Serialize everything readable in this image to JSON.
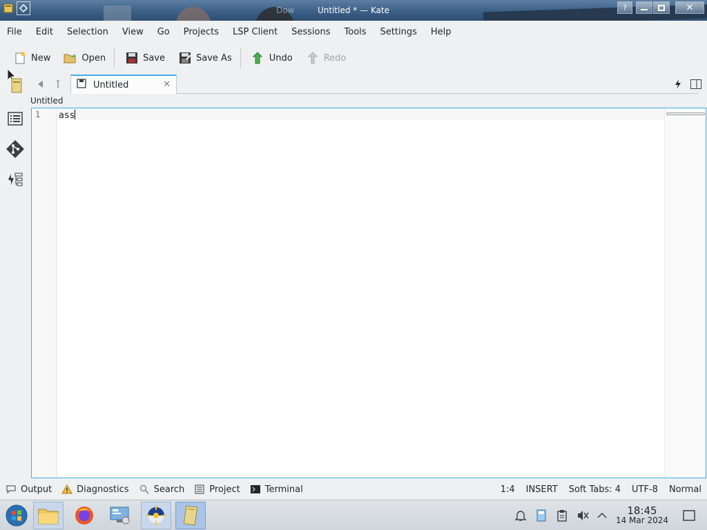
{
  "window": {
    "title": "Untitled * — Kate",
    "ghost_title": "Dow",
    "help_label": "?"
  },
  "menu": [
    "File",
    "Edit",
    "Selection",
    "View",
    "Go",
    "Projects",
    "LSP Client",
    "Sessions",
    "Tools",
    "Settings",
    "Help"
  ],
  "toolbar": {
    "new_label": "New",
    "open_label": "Open",
    "save_label": "Save",
    "save_as_label": "Save As",
    "undo_label": "Undo",
    "redo_label": "Redo"
  },
  "tab": {
    "label": "Untitled"
  },
  "document": {
    "name": "Untitled",
    "line_number": "1",
    "content": "ass"
  },
  "bottom_panel": {
    "output_label": "Output",
    "diagnostics_label": "Diagnostics",
    "search_label": "Search",
    "project_label": "Project",
    "terminal_label": "Terminal"
  },
  "status": {
    "cursor": "1:4",
    "mode": "INSERT",
    "indent": "Soft Tabs: 4",
    "encoding": "UTF-8",
    "input_mode": "Normal"
  },
  "clock": {
    "time": "18:45",
    "date": "14 Mar 2024"
  },
  "colors": {
    "accent": "#3daee9",
    "titlebar": "#3f6288",
    "background": "#eff0f1"
  }
}
